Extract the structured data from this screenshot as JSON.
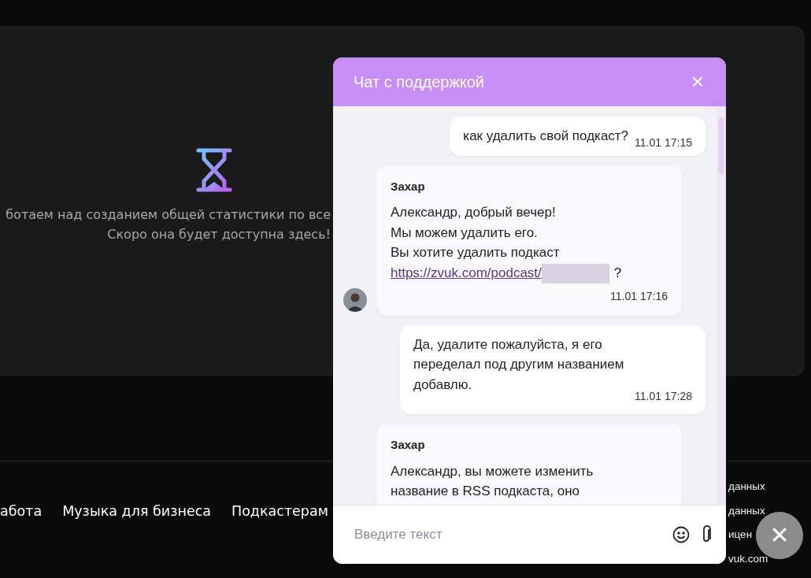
{
  "stats_placeholder": {
    "lines": [
      "ботаем над созданием общей статистики по все",
      "Скоро она будет доступна здесь!"
    ]
  },
  "footer": {
    "links": [
      "абота",
      "Музыка для бизнеса",
      "Подкастерам"
    ],
    "right_texts": [
      "данных",
      "данных",
      "ицен",
      "vuk.com"
    ]
  },
  "chat": {
    "title": "Чат с поддержкой",
    "close_label": "×",
    "messages": [
      {
        "kind": "outgoing",
        "text": "как удалить свой подкаст?",
        "time": "11.01 17:15"
      },
      {
        "kind": "incoming",
        "author": "Захар",
        "lines": [
          "Александр, добрый вечер!",
          "Мы можем удалить его.",
          "Вы хотите удалить подкаст"
        ],
        "link": "https://zvuk.com/podcast/",
        "redacted": true,
        "suffix": "?",
        "time": "11.01 17:16",
        "avatar": true
      },
      {
        "kind": "outgoing",
        "text": "Да, удалите пожалуйста, я его переделал под другим названием добавлю.",
        "time": "11.01 17:28"
      },
      {
        "kind": "incoming",
        "author": "Захар",
        "lines": [
          "Александр, вы можете изменить",
          "название в RSS подкаста, оно"
        ],
        "avatar": false
      }
    ],
    "input": {
      "placeholder": "Введите текст"
    }
  },
  "fab_label": "✕"
}
